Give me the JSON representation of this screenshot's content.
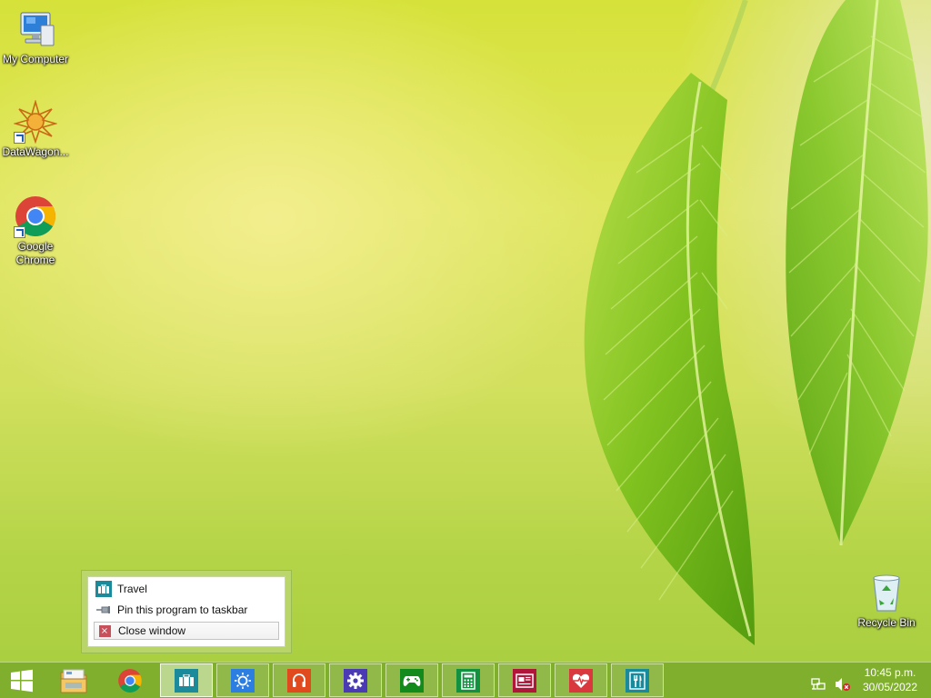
{
  "desktop": {
    "icons": [
      {
        "label": "My Computer",
        "icon": "computer-icon"
      },
      {
        "label": "DataWagon...",
        "icon": "datawagon-icon"
      },
      {
        "label": "Google Chrome",
        "icon": "chrome-icon"
      },
      {
        "label": "Recycle Bin",
        "icon": "recycle-bin-icon"
      }
    ]
  },
  "jumplist": {
    "app_title": "Travel",
    "pin_label": "Pin this program to taskbar",
    "close_label": "Close window"
  },
  "taskbar": {
    "start_icon": "windows-logo-icon",
    "pinned": [
      {
        "name": "file-explorer",
        "icon": "folder-icon"
      },
      {
        "name": "chrome",
        "icon": "chrome-icon"
      }
    ],
    "apps": [
      {
        "name": "travel",
        "icon": "suitcase-icon",
        "color": "#1b8a9a",
        "active": true
      },
      {
        "name": "weather",
        "icon": "sun-icon",
        "color": "#2c7fe0"
      },
      {
        "name": "music",
        "icon": "headphones-icon",
        "color": "#e04a1e"
      },
      {
        "name": "settings",
        "icon": "gear-icon",
        "color": "#4a3bb5"
      },
      {
        "name": "games",
        "icon": "gamepad-icon",
        "color": "#128a1c"
      },
      {
        "name": "calculator",
        "icon": "calculator-icon",
        "color": "#129140"
      },
      {
        "name": "news",
        "icon": "newspaper-icon",
        "color": "#b0163a"
      },
      {
        "name": "health",
        "icon": "heartbeat-icon",
        "color": "#d9383e"
      },
      {
        "name": "food",
        "icon": "fork-knife-icon",
        "color": "#178a9c"
      }
    ],
    "tray": {
      "network_icon": "network-icon",
      "volume_icon": "volume-muted-icon",
      "time": "10:45 p.m.",
      "date": "30/05/2022"
    }
  }
}
